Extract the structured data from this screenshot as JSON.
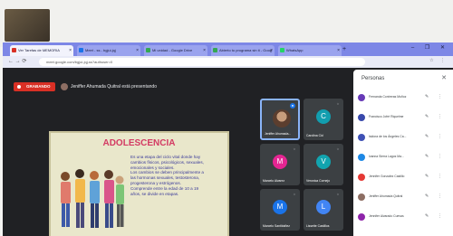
{
  "colors": {
    "tabbar": "#7d87e6",
    "recording": "#d93025",
    "meet_bg": "#202124",
    "slide_title": "#d33a63",
    "selected_tile": "#8ab4f8"
  },
  "browser": {
    "tabs": [
      {
        "label": "Ver Tarefas de MEMORIA",
        "favicon_color": "#d93025",
        "active": true
      },
      {
        "label": "Meet - ss - bgjui-jqj",
        "favicon_color": "#1a73e8",
        "active": false
      },
      {
        "label": "Mi unidad - Google Drive",
        "favicon_color": "#34a853",
        "active": false
      },
      {
        "label": "Abierto tu programa sin ti - Goog",
        "favicon_color": "#34a853",
        "active": false
      },
      {
        "label": "WhatsApp",
        "favicon_color": "#25d366",
        "active": false
      }
    ],
    "new_tab": "+",
    "window_controls": "– ❐ ✕",
    "nav_icons": "← → ⟳",
    "url": "meet.google.com/bgjui-jqj-ss?authuser=0",
    "toolbar_icons": "☆ ⋮"
  },
  "meet": {
    "recording_label": "GRABANDO",
    "presenter_text": "Jeniffer Ahumada Quitral está presentando"
  },
  "slide": {
    "title": "ADOLESCENCIA",
    "lines": [
      "Es una etapa del ciclo vital donde hay",
      "cambios físicos, psicológicos, sexuales,",
      "emocionales y sociales.",
      "Los cambios se deben principalmente a",
      "las hormonas sexuales, testosterona,",
      "progesterona y estrógenos.",
      "Comprende entre la edad de 10 a 19",
      "años, se divide en etapas."
    ]
  },
  "tiles": [
    {
      "name": "Jeniffer Ahumada...",
      "initial": "",
      "color": "#5c3e2e",
      "photo": true,
      "selected": true,
      "mic": "●"
    },
    {
      "name": "Carolina Cid",
      "initial": "C",
      "color": "#129eaf",
      "photo": false,
      "selected": false,
      "mic": "◌"
    },
    {
      "name": "Marcelo Alvarez",
      "initial": "M",
      "color": "#e52592",
      "photo": false,
      "selected": false,
      "mic": "◌"
    },
    {
      "name": "Veronica Cornejo",
      "initial": "V",
      "color": "#12a4af",
      "photo": false,
      "selected": false,
      "mic": "◌"
    },
    {
      "name": "Marcelo Santibáñez",
      "initial": "M",
      "color": "#1a73e8",
      "photo": false,
      "selected": false,
      "mic": "◌"
    },
    {
      "name": "Lissette Castillos",
      "initial": "L",
      "color": "#4285f4",
      "photo": false,
      "selected": false,
      "mic": "◌"
    }
  ],
  "people_panel": {
    "title": "Personas",
    "close": "✕",
    "rows": [
      {
        "name": "Fernanda Contreras Muñoz",
        "color": "#673ab7"
      },
      {
        "name": "Francisco Jofré Riquelme",
        "color": "#3949ab"
      },
      {
        "name": "Isidora de los Ángeles Ca...",
        "color": "#3f51b5"
      },
      {
        "name": "Ivanna Sierra Lagos Ma...",
        "color": "#1e88e5"
      },
      {
        "name": "Jennifer Gonzalez Castillo",
        "color": "#e53935"
      },
      {
        "name": "Jeniffer Ahumada Quitral",
        "color": "#8d6e63"
      },
      {
        "name": "Jennifer Alvarado Cuevas",
        "color": "#8e24aa"
      }
    ],
    "mic_icon": "🎙",
    "more_icon": "⋮"
  }
}
